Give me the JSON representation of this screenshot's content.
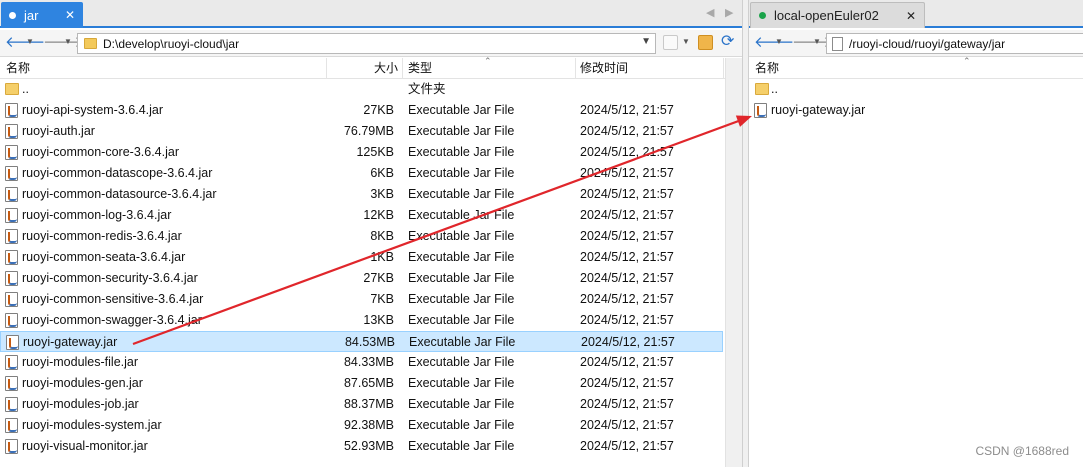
{
  "left": {
    "tab": {
      "label": "jar",
      "close": "✕"
    },
    "tab_nav": {
      "prev": "◀",
      "next": "▶"
    },
    "address": {
      "path": "D:\\develop\\ruoyi-cloud\\jar"
    },
    "columns": {
      "name": "名称",
      "size": "大小",
      "type": "类型",
      "modified": "修改时间"
    },
    "parent": {
      "name": "..",
      "type": "文件夹"
    },
    "files": [
      {
        "name": "ruoyi-api-system-3.6.4.jar",
        "size": "27KB",
        "type": "Executable Jar File",
        "modified": "2024/5/12, 21:57"
      },
      {
        "name": "ruoyi-auth.jar",
        "size": "76.79MB",
        "type": "Executable Jar File",
        "modified": "2024/5/12, 21:57"
      },
      {
        "name": "ruoyi-common-core-3.6.4.jar",
        "size": "125KB",
        "type": "Executable Jar File",
        "modified": "2024/5/12, 21:57"
      },
      {
        "name": "ruoyi-common-datascope-3.6.4.jar",
        "size": "6KB",
        "type": "Executable Jar File",
        "modified": "2024/5/12, 21:57"
      },
      {
        "name": "ruoyi-common-datasource-3.6.4.jar",
        "size": "3KB",
        "type": "Executable Jar File",
        "modified": "2024/5/12, 21:57"
      },
      {
        "name": "ruoyi-common-log-3.6.4.jar",
        "size": "12KB",
        "type": "Executable Jar File",
        "modified": "2024/5/12, 21:57"
      },
      {
        "name": "ruoyi-common-redis-3.6.4.jar",
        "size": "8KB",
        "type": "Executable Jar File",
        "modified": "2024/5/12, 21:57"
      },
      {
        "name": "ruoyi-common-seata-3.6.4.jar",
        "size": "1KB",
        "type": "Executable Jar File",
        "modified": "2024/5/12, 21:57"
      },
      {
        "name": "ruoyi-common-security-3.6.4.jar",
        "size": "27KB",
        "type": "Executable Jar File",
        "modified": "2024/5/12, 21:57"
      },
      {
        "name": "ruoyi-common-sensitive-3.6.4.jar",
        "size": "7KB",
        "type": "Executable Jar File",
        "modified": "2024/5/12, 21:57"
      },
      {
        "name": "ruoyi-common-swagger-3.6.4.jar",
        "size": "13KB",
        "type": "Executable Jar File",
        "modified": "2024/5/12, 21:57"
      },
      {
        "name": "ruoyi-gateway.jar",
        "size": "84.53MB",
        "type": "Executable Jar File",
        "modified": "2024/5/12, 21:57",
        "selected": true
      },
      {
        "name": "ruoyi-modules-file.jar",
        "size": "84.33MB",
        "type": "Executable Jar File",
        "modified": "2024/5/12, 21:57"
      },
      {
        "name": "ruoyi-modules-gen.jar",
        "size": "87.65MB",
        "type": "Executable Jar File",
        "modified": "2024/5/12, 21:57"
      },
      {
        "name": "ruoyi-modules-job.jar",
        "size": "88.37MB",
        "type": "Executable Jar File",
        "modified": "2024/5/12, 21:57"
      },
      {
        "name": "ruoyi-modules-system.jar",
        "size": "92.38MB",
        "type": "Executable Jar File",
        "modified": "2024/5/12, 21:57"
      },
      {
        "name": "ruoyi-visual-monitor.jar",
        "size": "52.93MB",
        "type": "Executable Jar File",
        "modified": "2024/5/12, 21:57"
      }
    ]
  },
  "right": {
    "tab": {
      "label": "local-openEuler02",
      "close": "✕"
    },
    "address": {
      "path": "/ruoyi-cloud/ruoyi/gateway/jar"
    },
    "columns": {
      "name": "名称"
    },
    "parent": {
      "name": ".."
    },
    "files": [
      {
        "name": "ruoyi-gateway.jar"
      }
    ]
  },
  "icons": {
    "back": "🡐",
    "forward": "🡒",
    "refresh": "⟳",
    "caret": "▼",
    "sort_up": "⌃"
  },
  "colors": {
    "accent": "#2f84e0",
    "selected_row": "#cce8ff",
    "connected_dot": "#1aa34a",
    "arrow": "#e0262b"
  },
  "watermark": "CSDN @1688red"
}
